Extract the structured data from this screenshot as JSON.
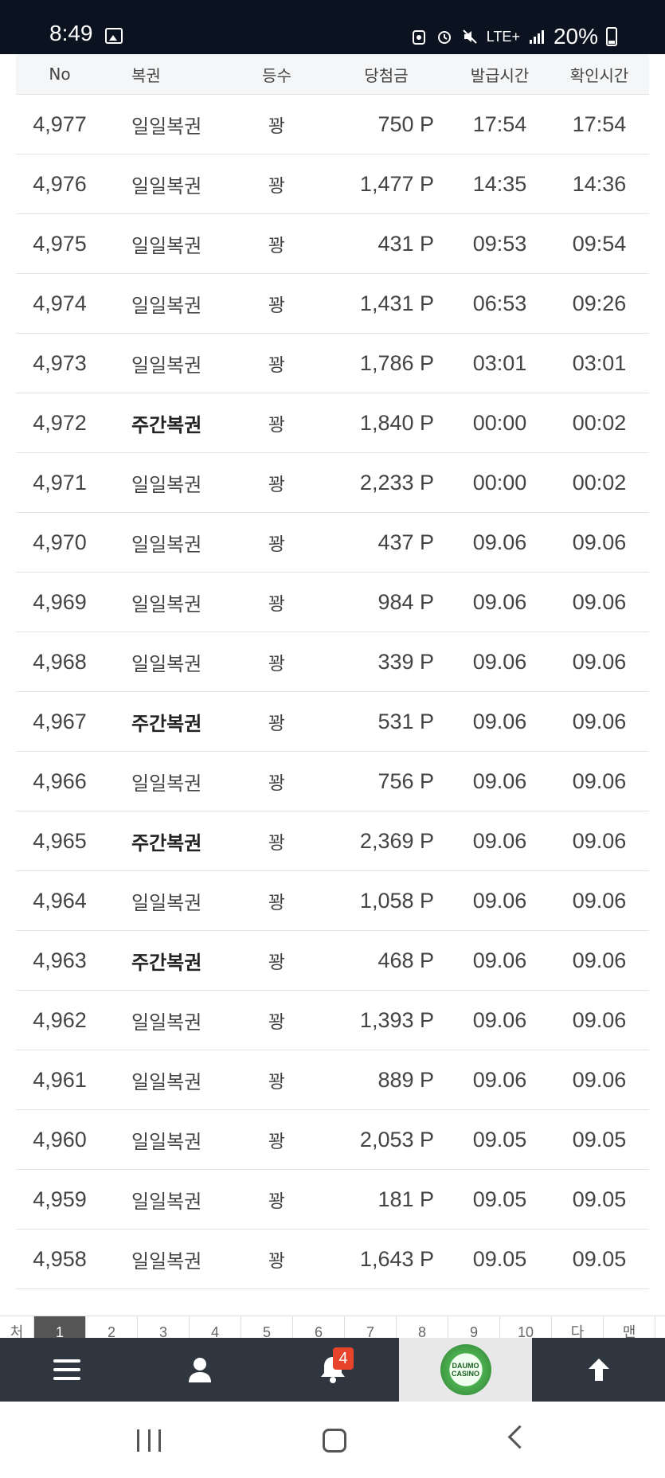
{
  "status_bar": {
    "time": "8:49",
    "network": "LTE+",
    "battery": "20%",
    "icons": [
      "image-icon",
      "recycle-icon",
      "alarm-icon",
      "mute-icon",
      "signal-icon",
      "battery-icon"
    ]
  },
  "table": {
    "headers": {
      "no": "No",
      "type": "복권",
      "rank": "등수",
      "prize": "당첨금",
      "issued": "발급시간",
      "checked": "확인시간"
    },
    "rows": [
      {
        "no": "4,977",
        "type": "일일복권",
        "rank": "꽝",
        "prize": "750 P",
        "issued": "17:54",
        "checked": "17:54"
      },
      {
        "no": "4,976",
        "type": "일일복권",
        "rank": "꽝",
        "prize": "1,477 P",
        "issued": "14:35",
        "checked": "14:36"
      },
      {
        "no": "4,975",
        "type": "일일복권",
        "rank": "꽝",
        "prize": "431 P",
        "issued": "09:53",
        "checked": "09:54"
      },
      {
        "no": "4,974",
        "type": "일일복권",
        "rank": "꽝",
        "prize": "1,431 P",
        "issued": "06:53",
        "checked": "09:26"
      },
      {
        "no": "4,973",
        "type": "일일복권",
        "rank": "꽝",
        "prize": "1,786 P",
        "issued": "03:01",
        "checked": "03:01"
      },
      {
        "no": "4,972",
        "type": "주간복권",
        "rank": "꽝",
        "prize": "1,840 P",
        "issued": "00:00",
        "checked": "00:02",
        "bold": true
      },
      {
        "no": "4,971",
        "type": "일일복권",
        "rank": "꽝",
        "prize": "2,233 P",
        "issued": "00:00",
        "checked": "00:02"
      },
      {
        "no": "4,970",
        "type": "일일복권",
        "rank": "꽝",
        "prize": "437 P",
        "issued": "09.06",
        "checked": "09.06"
      },
      {
        "no": "4,969",
        "type": "일일복권",
        "rank": "꽝",
        "prize": "984 P",
        "issued": "09.06",
        "checked": "09.06"
      },
      {
        "no": "4,968",
        "type": "일일복권",
        "rank": "꽝",
        "prize": "339 P",
        "issued": "09.06",
        "checked": "09.06"
      },
      {
        "no": "4,967",
        "type": "주간복권",
        "rank": "꽝",
        "prize": "531 P",
        "issued": "09.06",
        "checked": "09.06",
        "bold": true
      },
      {
        "no": "4,966",
        "type": "일일복권",
        "rank": "꽝",
        "prize": "756 P",
        "issued": "09.06",
        "checked": "09.06"
      },
      {
        "no": "4,965",
        "type": "주간복권",
        "rank": "꽝",
        "prize": "2,369 P",
        "issued": "09.06",
        "checked": "09.06",
        "bold": true
      },
      {
        "no": "4,964",
        "type": "일일복권",
        "rank": "꽝",
        "prize": "1,058 P",
        "issued": "09.06",
        "checked": "09.06"
      },
      {
        "no": "4,963",
        "type": "주간복권",
        "rank": "꽝",
        "prize": "468 P",
        "issued": "09.06",
        "checked": "09.06",
        "bold": true
      },
      {
        "no": "4,962",
        "type": "일일복권",
        "rank": "꽝",
        "prize": "1,393 P",
        "issued": "09.06",
        "checked": "09.06"
      },
      {
        "no": "4,961",
        "type": "일일복권",
        "rank": "꽝",
        "prize": "889 P",
        "issued": "09.06",
        "checked": "09.06"
      },
      {
        "no": "4,960",
        "type": "일일복권",
        "rank": "꽝",
        "prize": "2,053 P",
        "issued": "09.05",
        "checked": "09.05"
      },
      {
        "no": "4,959",
        "type": "일일복권",
        "rank": "꽝",
        "prize": "181 P",
        "issued": "09.05",
        "checked": "09.05"
      },
      {
        "no": "4,958",
        "type": "일일복권",
        "rank": "꽝",
        "prize": "1,643 P",
        "issued": "09.05",
        "checked": "09.05"
      }
    ]
  },
  "pagination": {
    "items": [
      "처",
      "1",
      "2",
      "3",
      "4",
      "5",
      "6",
      "7",
      "8",
      "9",
      "10",
      "다",
      "맨"
    ],
    "active": "1"
  },
  "bottom_nav": {
    "items": [
      "menu-icon",
      "user-icon",
      "bell-icon",
      "casino-logo",
      "arrow-up-icon"
    ],
    "notification_count": "4",
    "logo_text": "DAUMO CASINO"
  },
  "colors": {
    "status_bar_bg": "#0b1220",
    "nav_bg": "#2f3640",
    "badge_bg": "#e8442c",
    "header_bg": "#f5f6f7"
  }
}
